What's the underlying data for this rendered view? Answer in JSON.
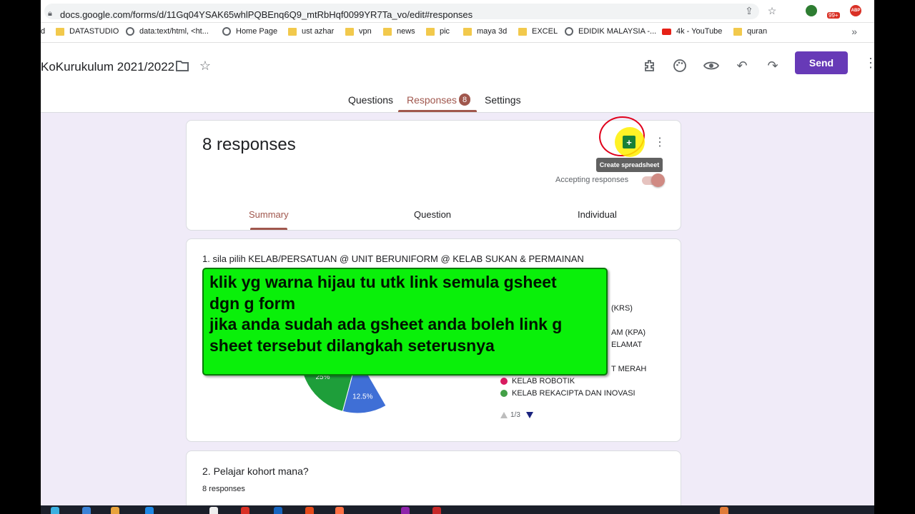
{
  "browser": {
    "url": "docs.google.com/forms/d/11Gq04YSAK65whlPQBEnq6Q9_mtRbHqf0099YR7Ta_vo/edit#responses",
    "extension_badge": "99+",
    "abp_label": "ABP"
  },
  "bookmarks": [
    {
      "label": "d",
      "icon": "folder-icon"
    },
    {
      "label": "DATASTUDIO",
      "icon": "folder-icon"
    },
    {
      "label": "data:text/html, <ht...",
      "icon": "globe-icon"
    },
    {
      "label": "Home Page",
      "icon": "globe-icon"
    },
    {
      "label": "ust azhar",
      "icon": "folder-icon"
    },
    {
      "label": "vpn",
      "icon": "folder-icon"
    },
    {
      "label": "news",
      "icon": "folder-icon"
    },
    {
      "label": "pic",
      "icon": "folder-icon"
    },
    {
      "label": "maya 3d",
      "icon": "folder-icon"
    },
    {
      "label": "EXCEL",
      "icon": "folder-icon"
    },
    {
      "label": "EDIDIK MALAYSIA -...",
      "icon": "globe-icon"
    },
    {
      "label": "4k - YouTube",
      "icon": "youtube-icon"
    },
    {
      "label": "quran",
      "icon": "folder-icon"
    }
  ],
  "bookmarks_more": "»",
  "form": {
    "title": "KoKurukulum 2021/2022",
    "send_label": "Send",
    "tabs": {
      "questions": "Questions",
      "responses": "Responses",
      "responses_count": "8",
      "settings": "Settings"
    }
  },
  "responses_card": {
    "title": "8 responses",
    "tooltip": "Create spreadsheet",
    "accepting_label": "Accepting responses",
    "accepting": true,
    "subtabs": {
      "summary": "Summary",
      "question": "Question",
      "individual": "Individual"
    }
  },
  "q1": {
    "title": "1. sila pilih KELAB/PERSATUAN @ UNIT BERUNIFORM @ KELAB SUKAN & PERMAINAN",
    "legend_partial": [
      "(KRS)",
      "AM (KPA)",
      "ELAMAT",
      "T MERAH"
    ],
    "legend": [
      {
        "label": "KELAB ROBOTIK",
        "color": "#d81b60"
      },
      {
        "label": "KELAB REKACIPTA DAN INOVASI",
        "color": "#43a047"
      }
    ],
    "pager": "1/3"
  },
  "chart_data": {
    "type": "pie",
    "slices": [
      {
        "label": "12.5%",
        "value": 12.5,
        "color": "#3f6fd6"
      },
      {
        "label": "25%",
        "value": 25,
        "color": "#1e9e3a"
      },
      {
        "label": "12.5%",
        "value": 12.5,
        "color": "#8e24aa"
      }
    ]
  },
  "q2": {
    "title": "2. Pelajar kohort mana?",
    "count": "8 responses"
  },
  "overlay": {
    "lines": [
      "klik yg warna hijau tu utk link semula gsheet",
      "dgn g form",
      "jika anda sudah ada gsheet anda boleh link g",
      "sheet tersebut dilangkah seterusnya"
    ]
  },
  "colors": {
    "accent": "#673ab7",
    "responses_accent": "#a0574d",
    "overlay_bg": "#0af00a"
  }
}
